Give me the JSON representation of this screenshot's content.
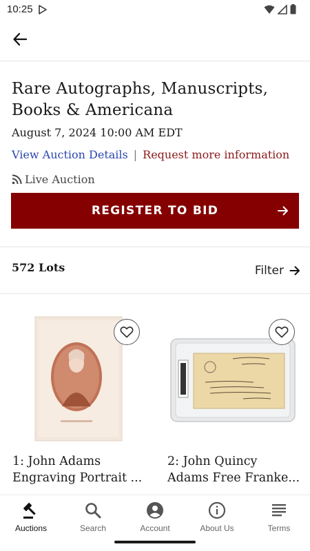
{
  "status_bar": {
    "time": "10:25"
  },
  "header": {
    "back_icon": "arrow-left-icon"
  },
  "auction": {
    "title": "Rare Autographs, Manuscripts, Books & Americana",
    "date": "August 7, 2024 10:00 AM EDT",
    "details_link": "View Auction Details",
    "separator": "|",
    "info_link": "Request more information",
    "type": "Live Auction",
    "register_label": "REGISTER TO BID"
  },
  "lots": {
    "count_label": "572 Lots",
    "filter_label": "Filter",
    "items": [
      {
        "title_line1": "1: John Adams",
        "title_line2": "Engraving Portrait ..."
      },
      {
        "title_line1": "2: John Quincy",
        "title_line2": "Adams Free Franke..."
      }
    ]
  },
  "bottom_nav": {
    "items": [
      {
        "label": "Auctions",
        "icon": "gavel-icon"
      },
      {
        "label": "Search",
        "icon": "search-icon"
      },
      {
        "label": "Account",
        "icon": "account-icon"
      },
      {
        "label": "About Us",
        "icon": "info-icon"
      },
      {
        "label": "Terms",
        "icon": "menu-lines-icon"
      }
    ]
  },
  "colors": {
    "accent": "#850000",
    "link": "#2a47b0",
    "info_link": "#8a1a1a"
  }
}
